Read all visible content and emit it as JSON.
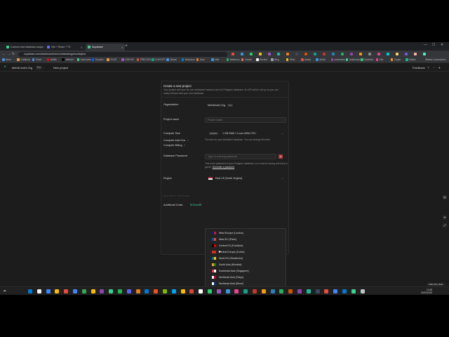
{
  "browser": {
    "tabs": [
      {
        "label": "Connect new database and m",
        "color": "#3ecf8e"
      },
      {
        "label": "Vite + React + TS",
        "color": "#646cff"
      },
      {
        "label": "Supabase",
        "color": "#3ecf8e"
      }
    ],
    "url": "supabase.com/dashboard/new/cnddwdsmgehwofwqhia",
    "bookmarks": [
      {
        "label": "Neue",
        "color": "#4a90d9"
      },
      {
        "label": "Collabora",
        "color": "#e2a03f"
      },
      {
        "label": "Ticket",
        "color": "#4a90d9"
      },
      {
        "label": "Netflix",
        "color": "#e50914"
      },
      {
        "label": "Jetbrain",
        "color": "#000000"
      },
      {
        "label": "Lawcounts",
        "color": "#3ecf8e"
      },
      {
        "label": "Dropbox",
        "color": "#0061ff"
      },
      {
        "label": "TOUR",
        "color": "#e2a03f"
      },
      {
        "label": "LINKVID",
        "color": "#9b59b6"
      },
      {
        "label": "PRECONS",
        "color": "#e74c3c"
      },
      {
        "label": "CHATGPT",
        "color": "#10a37f"
      },
      {
        "label": "Nikolai",
        "color": "#4a90d9"
      },
      {
        "label": "Nextcloud",
        "color": "#0082c9"
      },
      {
        "label": "Deal",
        "color": "#e67e22"
      },
      {
        "label": "Mail",
        "color": "#3498db"
      },
      {
        "label": "Wallenum",
        "color": "#27ae60"
      },
      {
        "label": "Claude",
        "color": "#d97757"
      },
      {
        "label": "Revolut",
        "color": "#ffffff"
      },
      {
        "label": "Blog",
        "color": "#95a5a6"
      },
      {
        "label": "Other",
        "color": "#f1c40f"
      },
      {
        "label": "Adobe",
        "color": "#e74c3c"
      },
      {
        "label": "Article",
        "color": "#3498db"
      },
      {
        "label": "extensions",
        "color": "#8e44ad"
      },
      {
        "label": "Dashboard",
        "color": "#3ecf8e"
      },
      {
        "label": "Synthetic",
        "color": "#2ecc71"
      },
      {
        "label": "Lifie",
        "color": "#e84393"
      },
      {
        "label": "Crypto",
        "color": "#f39c12"
      },
      {
        "label": "Mobile",
        "color": "#1abc9c"
      }
    ],
    "other_bookmarks": "Weitere Lesezeichen"
  },
  "header": {
    "org_name": "Mehdi mat's Org",
    "plan_badge": "Pro",
    "page": "New project",
    "feedback": "Feedback"
  },
  "form": {
    "title": "Create a new project",
    "description": "Your project will have its own dedicated instance and full Postgres database. An API will be set up so you can easily interact with your new database.",
    "organization_label": "Organization",
    "organization_value": "Mehdimat's Org",
    "organization_badge": "Pro",
    "project_name_label": "Project name",
    "project_name_placeholder": "Project name",
    "compute_size_label": "Compute Size",
    "compute_size_tag": "MICRO",
    "compute_size_value": "1 GB RAM / 2-core ARM CPU",
    "compute_size_help": "The size for your dedicated database. You can change this later.",
    "compute_addons_label": "Compute Add-Ons",
    "compute_billing_label": "Compute Billing",
    "db_password_label": "Database Password",
    "db_password_placeholder": "Type in a strong password",
    "db_password_help_prefix": "This is the password to your Postgres database, so it must be strong and hard to guess.",
    "generate_password_link": "Generate a password",
    "region_label": "Region",
    "region_value": "East US (North Virginia)",
    "security_options": "SECURITY OPTIONS",
    "additional_costs_label": "Additional Costs",
    "additional_costs_value": "$10/month"
  },
  "regions": [
    {
      "label": "West Europe (London)",
      "colors": [
        "#00247d",
        "#cf142b"
      ]
    },
    {
      "label": "West EU (Paris)",
      "colors": [
        "#0055a4",
        "#ef4135"
      ]
    },
    {
      "label": "Central EU (Frankfurt)",
      "colors": [
        "#000000",
        "#dd0000"
      ]
    },
    {
      "label": "Central Europe (Zurich)",
      "colors": [
        "#d52b1e",
        "#d52b1e"
      ]
    },
    {
      "label": "North EU (Stockholm)",
      "colors": [
        "#006aa7",
        "#fecc00"
      ]
    },
    {
      "label": "South Asia (Mumbai)",
      "colors": [
        "#ff9933",
        "#138808"
      ]
    },
    {
      "label": "Southeast Asia (Singapore)",
      "colors": [
        "#ef3340",
        "#ffffff"
      ]
    },
    {
      "label": "Northeast Asia (Tokyo)",
      "colors": [
        "#ffffff",
        "#bc002d"
      ]
    },
    {
      "label": "Northeast Asia (Seoul)",
      "colors": [
        "#ffffff",
        "#003478"
      ]
    },
    {
      "label": "Oceania (Sydney)",
      "colors": [
        "#00008b",
        "#00008b"
      ]
    },
    {
      "label": "South America (São Paulo)",
      "colors": [
        "#009c3b",
        "#ffdf00"
      ]
    }
  ],
  "taskbar": {
    "time": "10:38",
    "date": "02/06/2025",
    "toast": "CMD 100 | IDLE",
    "icon_colors": [
      "#0078d4",
      "#f0f0f0",
      "#3a86ff",
      "#ffb900",
      "#e74c3c",
      "#4285f4",
      "#34a853",
      "#fbbc05",
      "#8e44ad",
      "#3ecf8e",
      "#1db954",
      "#5865f2",
      "#e67e22",
      "#0078d4",
      "#f25022",
      "#7fba00",
      "#00a4ef",
      "#ffb900",
      "#db4437",
      "#ffffff",
      "#2ecc71",
      "#9b59b6",
      "#3498db",
      "#e84393",
      "#16a085",
      "#c0392b",
      "#f39c12",
      "#2980b9",
      "#27ae60",
      "#d35400",
      "#8e44ad",
      "#1abc9c",
      "#34495e",
      "#e74c3c",
      "#4285f4",
      "#0078d4",
      "#3ecf8e",
      "#bdc3c7"
    ]
  }
}
